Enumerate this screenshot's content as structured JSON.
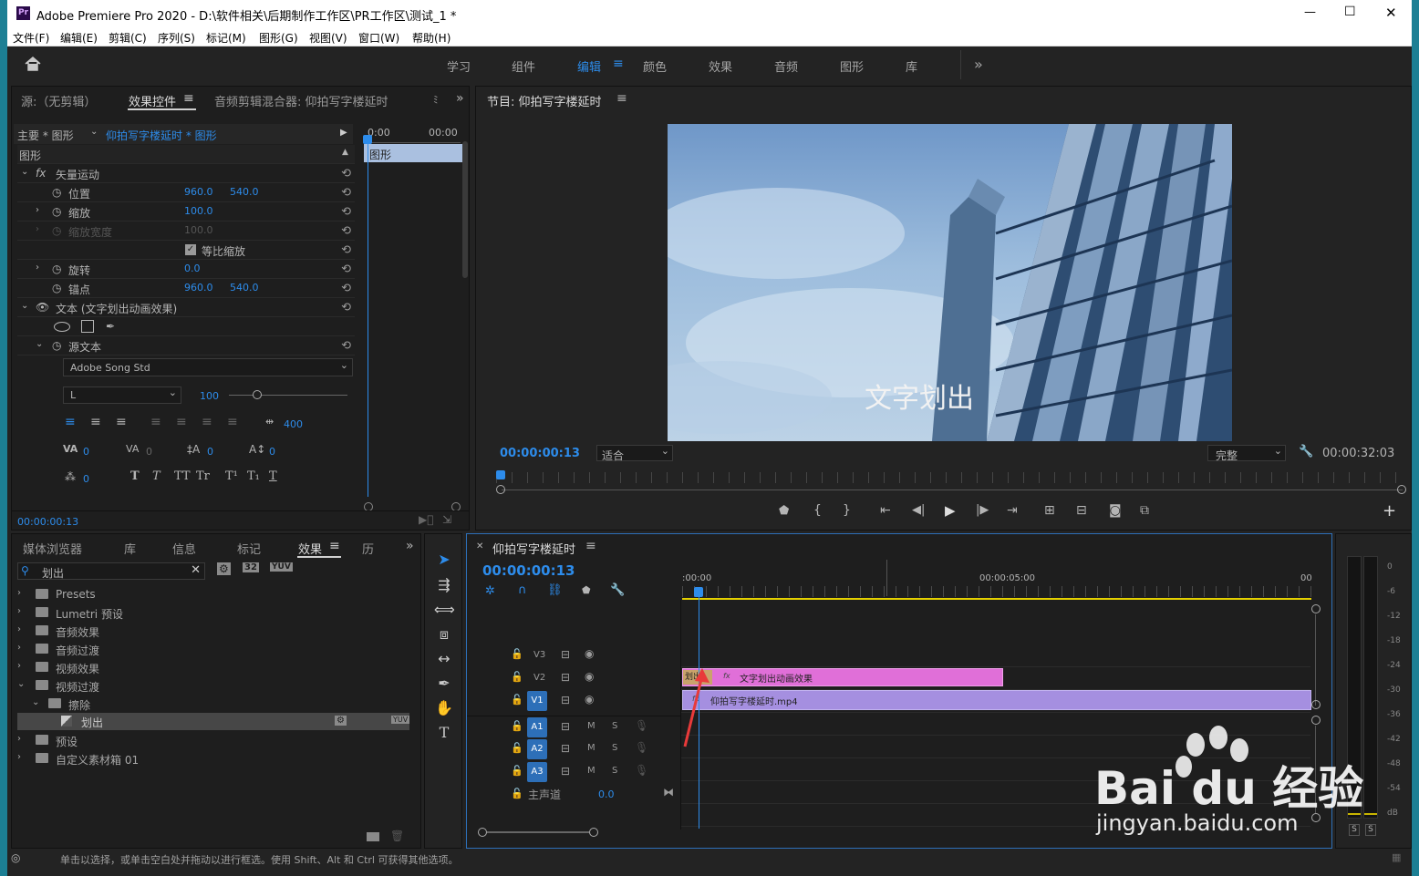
{
  "title": {
    "app_label": "Pr",
    "text": "Adobe Premiere Pro 2020 - D:\\软件相关\\后期制作工作区\\PR工作区\\测试_1 *"
  },
  "window_controls": {
    "minimize": "—",
    "maximize": "☐",
    "close": "✕"
  },
  "menu": [
    "文件(F)",
    "编辑(E)",
    "剪辑(C)",
    "序列(S)",
    "标记(M)",
    "图形(G)",
    "视图(V)",
    "窗口(W)",
    "帮助(H)"
  ],
  "workspaces": {
    "tabs": [
      "学习",
      "组件",
      "编辑",
      "颜色",
      "效果",
      "音频",
      "图形",
      "库"
    ],
    "active": "编辑",
    "more": "»"
  },
  "effect_panel": {
    "tabs": [
      "源:（无剪辑）",
      "效果控件",
      "音频剪辑混合器: 仰拍写字楼延时",
      "ﾐ"
    ],
    "active_tab": "效果控件",
    "master": "主要 * 图形",
    "clip": "仰拍写字楼延时 * 图形",
    "time_start": "0:00",
    "time_end": "00:00",
    "section": "图形",
    "clip_label": "图形",
    "vector_motion": "矢量运动",
    "props": [
      {
        "label": "位置",
        "v1": "960.0",
        "v2": "540.0"
      },
      {
        "label": "缩放",
        "v1": "100.0",
        "v2": ""
      },
      {
        "label": "缩放宽度",
        "v1": "100.0",
        "v2": ""
      },
      {
        "label": "旋转",
        "v1": "0.0",
        "v2": ""
      },
      {
        "label": "锚点",
        "v1": "960.0",
        "v2": "540.0"
      }
    ],
    "uniform_scale": "等比缩放",
    "text_layer": "文本 (文字划出动画效果)",
    "source_text": "源文本",
    "font": "Adobe Song Std",
    "font_style": "L",
    "font_size": "100",
    "tracking": "400",
    "kerning": "0",
    "tracking2": "0",
    "leading": "0",
    "baseline": "0",
    "tsume": "0",
    "text_styles": [
      "T",
      "T",
      "TT",
      "Tr",
      "T¹",
      "T₁",
      "T"
    ],
    "footer_time": "00:00:00:13"
  },
  "program": {
    "title": "节目: 仰拍写字楼延时",
    "overlay_text": "文字划出",
    "timecode": "00:00:00:13",
    "fit": "适合",
    "quality": "完整",
    "duration": "00:00:32:03",
    "controls": [
      "marker",
      "in",
      "out",
      "go-in",
      "step-back",
      "play",
      "step-forward",
      "go-out",
      "lift",
      "extract",
      "export-frame",
      "compare"
    ],
    "add": "+"
  },
  "effects_browser": {
    "tabs": [
      "媒体浏览器",
      "库",
      "信息",
      "标记",
      "效果",
      "历"
    ],
    "active_tab": "效果",
    "search_value": "划出",
    "items": [
      {
        "label": "Presets",
        "level": 0,
        "open": false,
        "selected": false
      },
      {
        "label": "Lumetri 预设",
        "level": 0,
        "open": false,
        "selected": false
      },
      {
        "label": "音频效果",
        "level": 0,
        "open": false,
        "selected": false
      },
      {
        "label": "音频过渡",
        "level": 0,
        "open": false,
        "selected": false
      },
      {
        "label": "视频效果",
        "level": 0,
        "open": false,
        "selected": false
      },
      {
        "label": "视频过渡",
        "level": 0,
        "open": true,
        "selected": false
      },
      {
        "label": "擦除",
        "level": 1,
        "open": true,
        "selected": false
      },
      {
        "label": "划出",
        "level": 2,
        "open": false,
        "selected": true
      },
      {
        "label": "预设",
        "level": 0,
        "open": false,
        "selected": false
      },
      {
        "label": "自定义素材箱 01",
        "level": 0,
        "open": false,
        "selected": false
      }
    ]
  },
  "tools": [
    "selection",
    "track-select",
    "ripple-edit",
    "razor",
    "slip",
    "pen",
    "hand",
    "type"
  ],
  "timeline": {
    "title": "仰拍写字楼延时",
    "timecode": "00:00:00:13",
    "ruler": [
      ":00:00",
      "00:00:05:00",
      "00"
    ],
    "tracks": [
      {
        "name": "V3",
        "active": false,
        "kind": "video"
      },
      {
        "name": "V2",
        "active": false,
        "kind": "video"
      },
      {
        "name": "V1",
        "active": true,
        "kind": "video"
      },
      {
        "name": "A1",
        "active": true,
        "kind": "audio"
      },
      {
        "name": "A2",
        "active": true,
        "kind": "audio"
      },
      {
        "name": "A3",
        "active": true,
        "kind": "audio"
      }
    ],
    "track_m": "M",
    "track_s": "S",
    "master": "主声道",
    "master_value": "0.0",
    "clip_v2": "文字划出动画效果",
    "clip_v2_transition": "划出",
    "clip_v1": "仰拍写字楼延时.mp4"
  },
  "meter": {
    "scale": [
      "0",
      "-6",
      "-12",
      "-18",
      "-24",
      "-30",
      "-36",
      "-42",
      "-48",
      "-54",
      "dB"
    ],
    "solo": [
      "S",
      "S"
    ]
  },
  "status": {
    "text": "单击以选择，或单击空白处并拖动以进行框选。使用 Shift、Alt 和 Ctrl 可获得其他选项。"
  },
  "watermark": {
    "brand": "Bai du 经验",
    "url": "jingyan.baidu.com"
  }
}
